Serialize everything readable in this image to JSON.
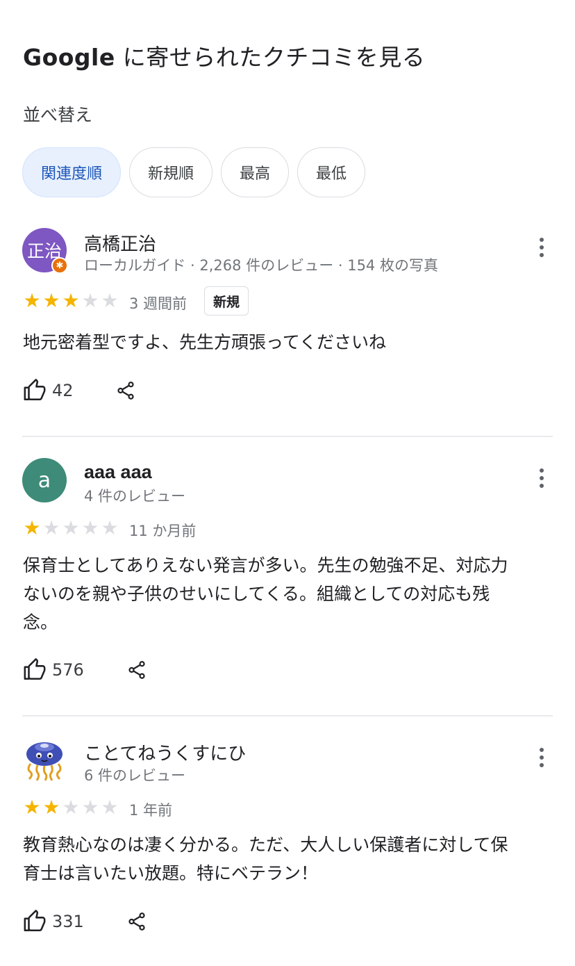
{
  "header": {
    "title_brand": "Google",
    "title_rest": " に寄せられたクチコミを見る",
    "sort_label": "並べ替え"
  },
  "sort_chips": [
    {
      "label": "関連度順",
      "selected": true
    },
    {
      "label": "新規順",
      "selected": false
    },
    {
      "label": "最高",
      "selected": false
    },
    {
      "label": "最低",
      "selected": false
    }
  ],
  "reviews": [
    {
      "name": "高橋正治",
      "avatar_text": "正治",
      "avatar_color": "#7e57c2",
      "meta": "ローカルガイド · 2,268 件のレビュー · 154 枚の写真",
      "rating": 3,
      "date": "3 週間前",
      "badge": "新規",
      "text": "地元密着型ですよ、先生方頑張ってくださいね",
      "likes": "42"
    },
    {
      "name": "aaa aaa",
      "avatar_text": "a",
      "avatar_color": "#3d8b78",
      "meta": "4 件のレビュー",
      "rating": 1,
      "date": "11 か月前",
      "text": "保育士としてありえない発言が多い。先生の勉強不足、対応力ないのを親や子供のせいにしてくる。組織としての対応も残念。",
      "likes": "576"
    },
    {
      "name": "ことてねうくすにひ",
      "avatar_icon": "jellyfish-avatar-icon",
      "meta": "6 件のレビュー",
      "rating": 2,
      "date": "1 年前",
      "text": "教育熱心なのは凄く分かる。ただ、大人しい保護者に対して保育士は言いたい放題。特にベテラン！",
      "likes": "331"
    }
  ],
  "colors": {
    "star_on": "#f4b400",
    "star_off": "#dadce0",
    "chip_selected_bg": "#e8f0fe",
    "chip_selected_text": "#1a55b8"
  }
}
